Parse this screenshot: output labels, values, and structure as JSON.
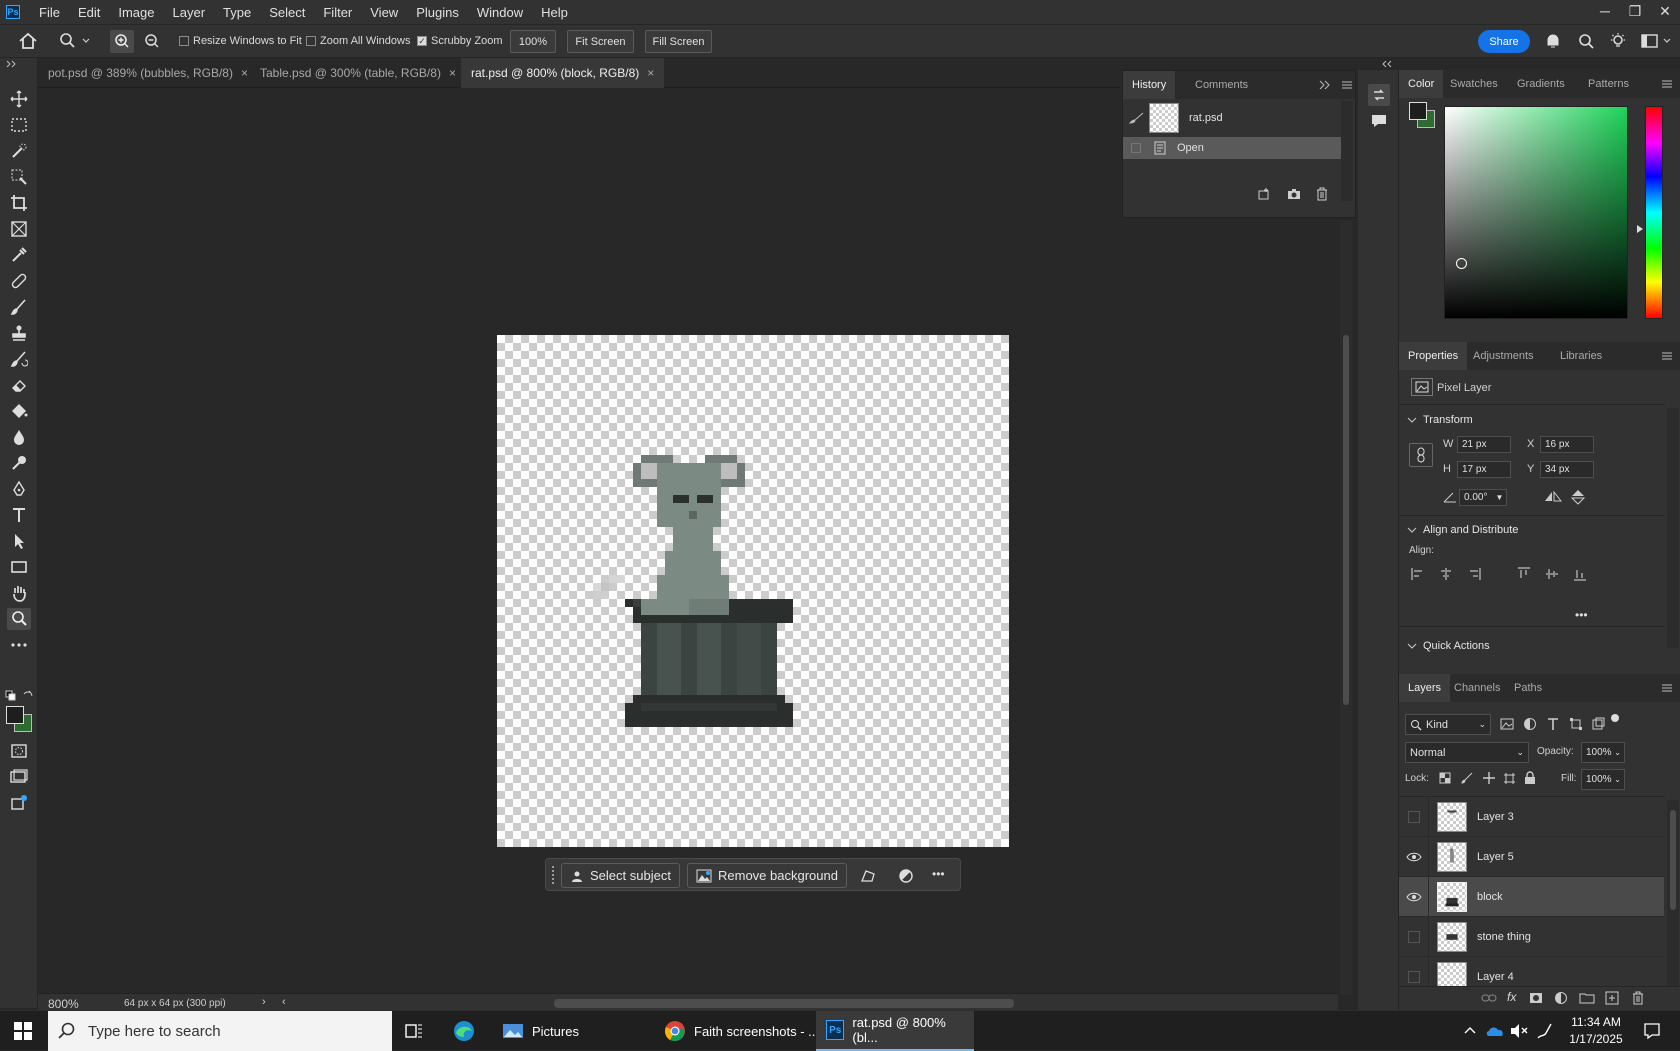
{
  "app": {
    "logo_text": "Ps"
  },
  "menu": [
    "File",
    "Edit",
    "Image",
    "Layer",
    "Type",
    "Select",
    "Filter",
    "View",
    "Plugins",
    "Window",
    "Help"
  ],
  "window_controls": [
    "─",
    "❐",
    "✕"
  ],
  "options": {
    "resize_windows": "Resize Windows to Fit",
    "zoom_all": "Zoom All Windows",
    "scrubby_zoom": "Scrubby Zoom",
    "zoom_value": "100%",
    "fit_screen": "Fit Screen",
    "fill_screen": "Fill Screen",
    "share": "Share"
  },
  "tabs": [
    {
      "label": "pot.psd @ 389% (bubbles, RGB/8)",
      "close": "×"
    },
    {
      "label": "Table.psd @ 300% (table, RGB/8)",
      "close": "×"
    },
    {
      "label": "rat.psd @ 800% (block, RGB/8)",
      "close": "×"
    }
  ],
  "contextual_bar": {
    "select_subject": "Select subject",
    "remove_background": "Remove background",
    "more": "•••"
  },
  "status": {
    "zoom": "800%",
    "doc_info": "64 px x 64 px (300 ppi)",
    "arrow": "›",
    "left_arrow": "‹"
  },
  "history": {
    "tabs": [
      "History",
      "Comments"
    ],
    "snapshot": "rat.psd",
    "items": [
      "Open"
    ]
  },
  "color_panel": {
    "tabs": [
      "Color",
      "Swatches",
      "Gradients",
      "Patterns"
    ],
    "fg": "#1e1e1e",
    "bg": "#2d6b31"
  },
  "properties": {
    "tabs": [
      "Properties",
      "Adjustments",
      "Libraries"
    ],
    "layer_type": "Pixel Layer",
    "transform_title": "Transform",
    "w_label": "W",
    "w": "21 px",
    "h_label": "H",
    "h": "17 px",
    "x_label": "X",
    "x": "16 px",
    "y_label": "Y",
    "y": "34 px",
    "angle": "0.00°",
    "align_title": "Align and Distribute",
    "align_label": "Align:",
    "more": "•••",
    "quick_actions": "Quick Actions"
  },
  "layers_panel": {
    "tabs": [
      "Layers",
      "Channels",
      "Paths"
    ],
    "filter": "Kind",
    "blend_mode": "Normal",
    "opacity_label": "Opacity:",
    "opacity": "100%",
    "lock_label": "Lock:",
    "fill_label": "Fill:",
    "fill": "100%",
    "layers": [
      {
        "name": "Layer 3",
        "visible": false,
        "selected": false
      },
      {
        "name": "Layer 5",
        "visible": true,
        "selected": false
      },
      {
        "name": "block",
        "visible": true,
        "selected": true
      },
      {
        "name": "stone thing",
        "visible": false,
        "selected": false
      },
      {
        "name": "Layer 4",
        "visible": false,
        "selected": false
      }
    ]
  },
  "taskbar": {
    "search_placeholder": "Type here to search",
    "apps": [
      {
        "label": "Pictures"
      },
      {
        "label": "Faith screenshots - ..."
      },
      {
        "label": "rat.psd @ 800% (bl..."
      }
    ],
    "time": "11:34 AM",
    "date": "1/17/2025"
  }
}
